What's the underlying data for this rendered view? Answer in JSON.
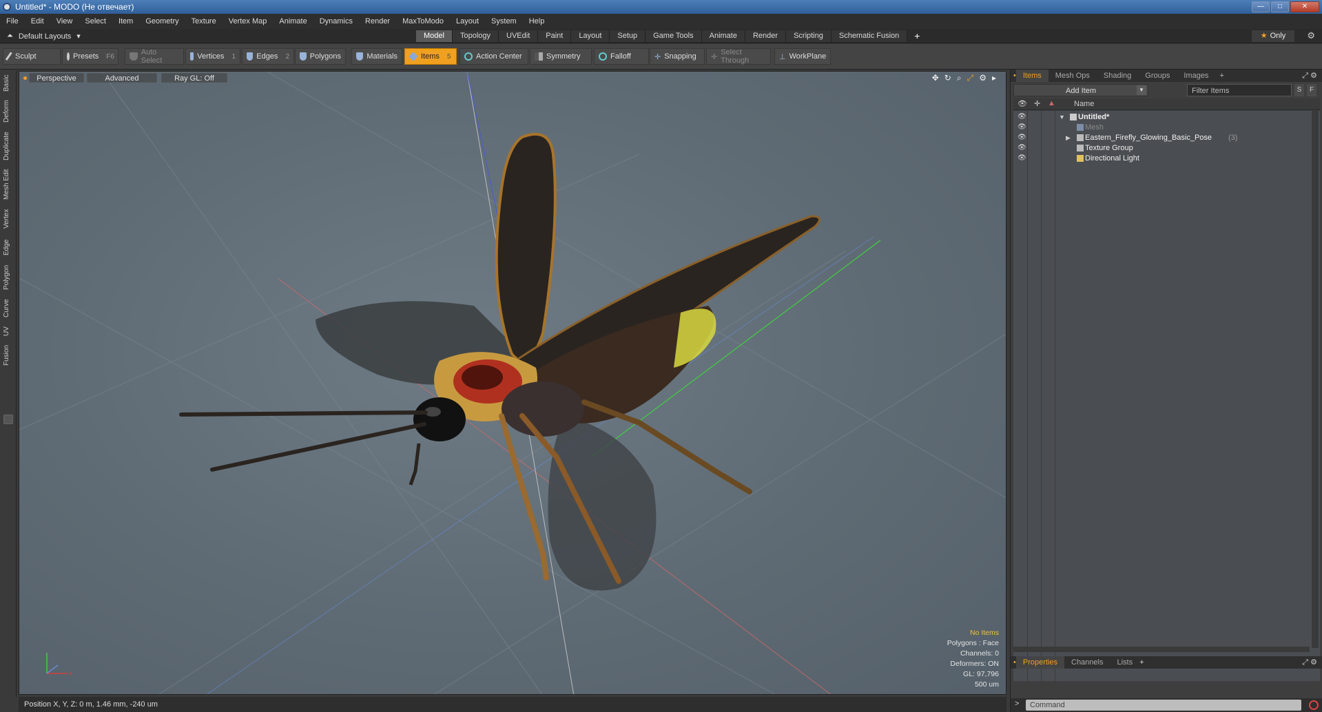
{
  "window": {
    "title": "Untitled* - MODO (Не отвечает)"
  },
  "menu": [
    "File",
    "Edit",
    "View",
    "Select",
    "Item",
    "Geometry",
    "Texture",
    "Vertex Map",
    "Animate",
    "Dynamics",
    "Render",
    "MaxToModo",
    "Layout",
    "System",
    "Help"
  ],
  "layout": {
    "name": "Default Layouts",
    "tabs": [
      "Model",
      "Topology",
      "UVEdit",
      "Paint",
      "Layout",
      "Setup",
      "Game Tools",
      "Animate",
      "Render",
      "Scripting",
      "Schematic Fusion"
    ],
    "active_tab": "Model",
    "only_label": "Only"
  },
  "toolbar": {
    "sculpt": "Sculpt",
    "presets": "Presets",
    "presets_key": "F6",
    "auto_select": "Auto Select",
    "vertices": "Vertices",
    "vertices_key": "1",
    "edges": "Edges",
    "edges_key": "2",
    "polygons": "Polygons",
    "materials": "Materials",
    "items": "Items",
    "items_key": "5",
    "action_center": "Action Center",
    "symmetry": "Symmetry",
    "falloff": "Falloff",
    "snapping": "Snapping",
    "select_through": "Select Through",
    "workplane": "WorkPlane"
  },
  "left_tabs": [
    "Basic",
    "Deform",
    "Duplicate",
    "Mesh Edit",
    "Vertex",
    "Edge",
    "Polygon",
    "Curve",
    "UV",
    "Fusion"
  ],
  "viewport": {
    "view": "Perspective",
    "shading": "Advanced",
    "raygl": "Ray GL: Off",
    "stats": {
      "selection": "No Items",
      "polygons": "Polygons : Face",
      "channels": "Channels: 0",
      "deformers": "Deformers: ON",
      "gl": "GL: 97,796",
      "scale": "500 um"
    }
  },
  "status": {
    "position": "Position X, Y, Z:  0 m, 1.46 mm, -240 um"
  },
  "panel": {
    "tabs": [
      "Items",
      "Mesh Ops",
      "Shading",
      "Groups",
      "Images"
    ],
    "active_tab": "Items",
    "add_item": "Add Item",
    "filter_placeholder": "Filter Items",
    "s_btn": "S",
    "f_btn": "F",
    "name_col": "Name",
    "tree": {
      "scene": "Untitled*",
      "mesh": "Mesh",
      "group": "Eastern_Firefly_Glowing_Basic_Pose",
      "group_count": "(3)",
      "texture_group": "Texture Group",
      "light": "Directional Light"
    },
    "bottom_tabs": [
      "Properties",
      "Channels",
      "Lists"
    ],
    "command_placeholder": "Command"
  },
  "colors": {
    "accent": "#f0a020",
    "viewport_bg": "#5f6b74",
    "panel_bg": "#4a4e52"
  }
}
